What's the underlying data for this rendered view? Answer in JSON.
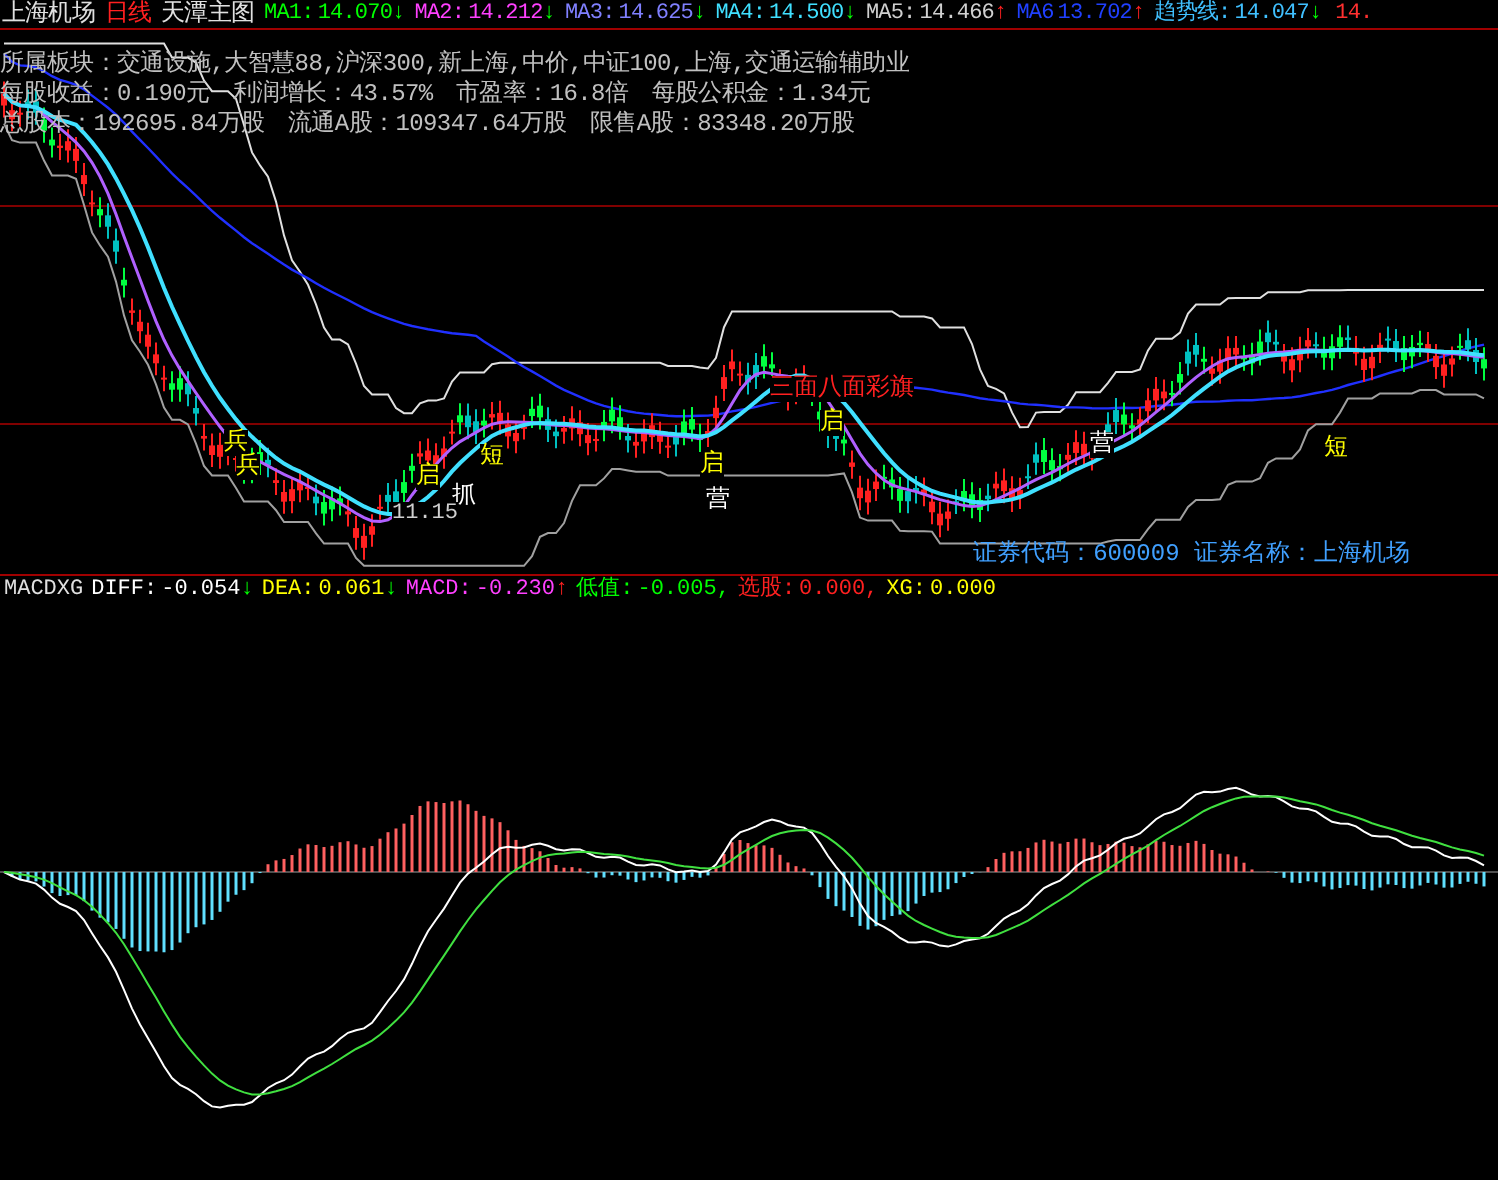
{
  "header": {
    "stock": "上海机场",
    "period": "日线",
    "template": "天潭主图",
    "indicators": [
      {
        "label": "MA1:",
        "value": "14.070",
        "arrow": "↓",
        "rising": false,
        "color": "#00ff00"
      },
      {
        "label": "MA2:",
        "value": "14.212",
        "arrow": "↓",
        "rising": false,
        "color": "#ff40ff"
      },
      {
        "label": "MA3:",
        "value": "14.625",
        "arrow": "↓",
        "rising": false,
        "color": "#8080ff"
      },
      {
        "label": "MA4:",
        "value": "14.500",
        "arrow": "↓",
        "rising": false,
        "color": "#40e0ff"
      },
      {
        "label": "MA5:",
        "value": "14.466",
        "arrow": "↑",
        "rising": true,
        "color": "#d0d0d0"
      },
      {
        "label": "MA6",
        "value": "13.702",
        "arrow": "↑",
        "rising": true,
        "color": "#2040ff"
      },
      {
        "label": "趋势线:",
        "value": "14.047",
        "arrow": "↓",
        "rising": false,
        "color": "#40c0ff"
      },
      {
        "value": "14.",
        "color": "#ff3030"
      }
    ]
  },
  "info_lines": [
    "所属板块：交通设施,大智慧88,沪深300,新上海,中价,中证100,上海,交通运输辅助业",
    "每股收益：0.190元　利润增长：43.57%　市盈率：16.8倍　每股公积金：1.34元",
    "总股本：192695.84万股　流通A股：109347.64万股　限售A股：83348.20万股"
  ],
  "price_chart": {
    "low_label": "11.15",
    "marks": [
      {
        "text": "兵",
        "color": "#ffff00"
      },
      {
        "text": "兵",
        "color": "#ffff00"
      },
      {
        "text": "启",
        "color": "#ffff00"
      },
      {
        "text": "抓",
        "color": "#ffffff"
      },
      {
        "text": "短",
        "color": "#ffff00"
      },
      {
        "text": "启",
        "color": "#ffff00"
      },
      {
        "text": "营",
        "color": "#ffffff"
      },
      {
        "text": "三面八面彩旗",
        "color": "#ff2020"
      },
      {
        "text": "启",
        "color": "#ffff00"
      },
      {
        "text": "营",
        "color": "#ffffff"
      },
      {
        "text": "短",
        "color": "#ffff00"
      }
    ],
    "security": "证券代码：600009 证券名称：上海机场"
  },
  "macd": {
    "title": "MACDXG",
    "fields": [
      {
        "label": "DIFF:",
        "value": "-0.054",
        "arrow": "↓",
        "rising": false,
        "color": "#ffffff"
      },
      {
        "label": "DEA:",
        "value": "0.061",
        "arrow": "↓",
        "rising": false,
        "color": "#ffff00"
      },
      {
        "label": "MACD:",
        "value": "-0.230",
        "arrow": "↑",
        "rising": true,
        "color": "#ff40ff"
      },
      {
        "label": "低值:",
        "value": "-0.005,",
        "color": "#00ff00"
      },
      {
        "label": "选股:",
        "value": "0.000,",
        "color": "#ff2020"
      },
      {
        "label": "XG:",
        "value": "0.000",
        "color": "#ffff00"
      }
    ]
  }
}
